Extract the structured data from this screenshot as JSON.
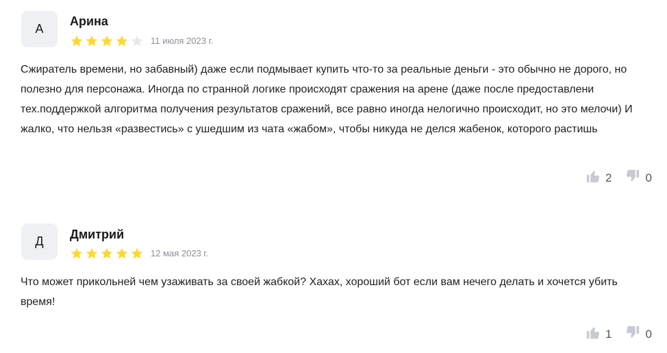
{
  "reviews": [
    {
      "avatar_letter": "А",
      "author": "Арина",
      "rating": 4,
      "max_rating": 5,
      "date": "11 июля 2023 г.",
      "text": "Сжиратель времени, но забавный) даже если подмывает купить что-то за реальные деньги - это обычно не дорого, но полезно для персонажа. Иногда по странной логике происходят сражения на арене (даже после предоставлени тех.поддержкой алгоритма получения результатов сражений, все равно иногда нелогично происходит, но это мелочи) И жалко, что нельзя «развестись» с ушедшим из чата «жабом», чтобы никуда не делся жабенок, которого растишь",
      "likes": "2",
      "dislikes": "0"
    },
    {
      "avatar_letter": "Д",
      "author": "Дмитрий",
      "rating": 5,
      "max_rating": 5,
      "date": "12 мая 2023 г.",
      "text": "Что может прикольней чем узаживать за своей жабкой? Хахах, хороший бот если вам нечего делать и хочется убить время!",
      "likes": "1",
      "dislikes": "0"
    }
  ],
  "colors": {
    "star_filled": "#fdd835",
    "star_empty": "#e6e8ec",
    "vote_icon": "#c7cbd1"
  }
}
